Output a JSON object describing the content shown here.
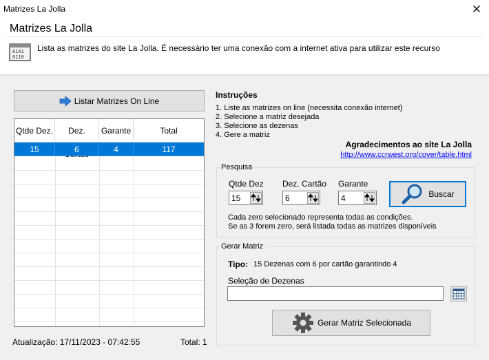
{
  "window": {
    "title": "Matrizes La Jolla",
    "close_glyph": "✕"
  },
  "header": {
    "title": "Matrizes La Jolla",
    "description": "Lista as matrizes do site La Jolla. É necessário ter uma conexão com a internet ativa para utilizar este recurso",
    "icon": "binary-data-icon"
  },
  "left": {
    "listar_button": "Listar Matrizes On Line",
    "grid": {
      "columns": [
        "Qtde Dez.",
        "Dez. Cartão",
        "Garante",
        "Total"
      ],
      "rows": [
        {
          "qtde": "15",
          "dez": "6",
          "garante": "4",
          "total": "117",
          "selected": true
        }
      ]
    },
    "status_updated": "Atualização: 17/11/2023 - 07:42:55",
    "status_total": "Total: 1"
  },
  "instructions": {
    "title": "Instruções",
    "steps": [
      "1. Liste as matrizes on line (necessita conexão internet)",
      "2. Selecione a matriz desejada",
      "3. Selecione as dezenas",
      "4. Gere a matriz"
    ],
    "thanks": "Agradecimentos ao site La Jolla",
    "link": "http://www.ccrwest.org/cover/table.html"
  },
  "pesquisa": {
    "legend": "Pesquisa",
    "qtde_label": "Qtde Dez",
    "qtde_value": "15",
    "dez_label": "Dez. Cartão",
    "dez_value": "6",
    "garante_label": "Garante",
    "garante_value": "4",
    "buscar_button": "Buscar",
    "note_line1": "Cada zero selecionado representa todas as condições.",
    "note_line2": "Se as 3 forem zero, será listada todas as matrizes disponíveis"
  },
  "gerar": {
    "legend": "Gerar Matriz",
    "tipo_label": "Tipo:",
    "tipo_value": "15 Dezenas com 6 por cartão garantindo 4",
    "selecao_label": "Seleção de Dezenas",
    "selecao_value": "",
    "gerar_button": "Gerar Matriz Selecionada"
  },
  "colors": {
    "accent": "#0078d7",
    "link": "#0000ff",
    "panel": "#f0f0f0"
  }
}
